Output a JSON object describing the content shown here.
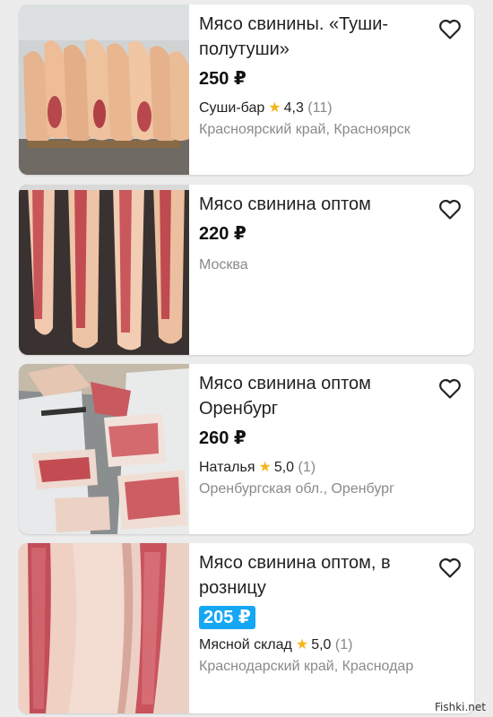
{
  "listings": [
    {
      "title": "Мясо свинины. «Туши-полутуши»",
      "price": "250 ₽",
      "seller": "Суши-бар",
      "rating": "4,3",
      "reviews": "(11)",
      "location": "Красноярский край, Красноярск",
      "image_icon": "pork-carcasses-photo",
      "favorite_icon": "heart-outline-icon"
    },
    {
      "title": "Мясо свинина оптом",
      "price": "220 ₽",
      "location": "Москва",
      "image_icon": "pork-sides-photo",
      "favorite_icon": "heart-outline-icon"
    },
    {
      "title": "Мясо свинина оптом Оренбург",
      "price": "260 ₽",
      "seller": "Наталья",
      "rating": "5,0",
      "reviews": "(1)",
      "location": "Оренбургская обл., Оренбург",
      "image_icon": "pork-cuts-photo",
      "favorite_icon": "heart-outline-icon"
    },
    {
      "title": "Мясо свинина оптом, в розницу",
      "price": "205 ₽",
      "price_highlighted": true,
      "seller": "Мясной склад",
      "rating": "5,0",
      "reviews": "(1)",
      "location": "Краснодарский край, Краснодар",
      "image_icon": "pork-sides-closeup-photo",
      "favorite_icon": "heart-outline-icon"
    }
  ],
  "watermark": "Fishki.net",
  "colors": {
    "star": "#f7b51c",
    "price_highlight": "#16a7f4",
    "muted_text": "#8a8a8a"
  }
}
